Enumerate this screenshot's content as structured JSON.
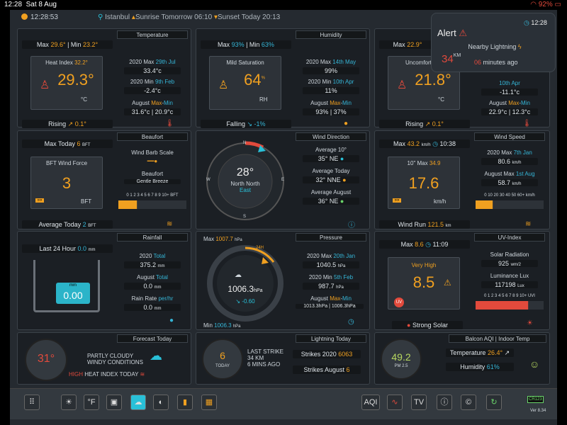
{
  "status": {
    "time": "12:28",
    "date": "Sat 8 Aug",
    "battery": "92%"
  },
  "topbar": {
    "clock": "12:28:53",
    "location": "Istanbul",
    "sunrise": "Sunrise Tomorrow 06:10",
    "sunset": "Sunset Today 20:13"
  },
  "temperature": {
    "header": "Temperature",
    "max_label": "Max",
    "max": "29.6°",
    "min_label": "Min",
    "min": "23.2°",
    "heat_index_label": "Heat Index",
    "heat_index": "32.2°",
    "value": "29.3°",
    "unit": "°C",
    "trend": "Rising",
    "trend_val": "0.1°",
    "y2020max_label": "2020 Max",
    "y2020max_date": "29th Jul",
    "y2020max": "33.4°c",
    "y2020min_label": "2020 Min",
    "y2020min_date": "9th Feb",
    "y2020min": "-2.4°c",
    "month_label": "August",
    "month_max": "Max",
    "month_min": "Min",
    "month_val": "31.6°c | 20.9°c"
  },
  "humidity": {
    "header": "Humidity",
    "max": "93%",
    "min": "63%",
    "sub": "Mild Saturation",
    "value": "64",
    "unit": "RH",
    "trend": "Falling",
    "trend_val": "-1%",
    "y2020max_label": "2020 Max",
    "y2020max_date": "14th May",
    "y2020max": "99%",
    "y2020min_label": "2020 Min",
    "y2020min_date": "10th Apr",
    "y2020min": "11%",
    "month_label": "August",
    "month_val": "93% | 37%"
  },
  "indoor": {
    "max": "22.9°",
    "sub": "Uncomfortable",
    "value": "21.8°",
    "unit": "°C",
    "trend": "Rising",
    "trend_val": "0.1°",
    "y2020min_date": "10th Apr",
    "y2020min": "-11.1°c",
    "month_label": "August",
    "month_val": "22.9°c | 12.3°c"
  },
  "alert": {
    "title": "Alert",
    "time": "12:28",
    "text": "Nearby Lightning",
    "dist": "34",
    "dist_unit": "KM",
    "mins": "06",
    "mins_label": "minutes ago"
  },
  "beaufort": {
    "header": "Beaufort",
    "max_today": "Max Today",
    "max_val": "6",
    "bft": "BFT",
    "force_label": "BFT Wind Force",
    "value": "3",
    "scale_label": "Wind Barb Scale",
    "beaufort_label": "Beaufort",
    "desc": "Gentle Breeze",
    "scale": "0 1 2 3 4 5 6 7 8 9 10+",
    "avg_label": "Average Today",
    "avg_val": "2"
  },
  "winddir": {
    "header": "Wind Direction",
    "degrees": "28°",
    "name": "North North",
    "name2": "East",
    "avg10_label": "Average 10°",
    "avg10": "35° NE",
    "avg_today_label": "Average Today",
    "avg_today": "32° NNE",
    "avg_aug_label": "Average August",
    "avg_aug": "36° NE",
    "n": "N",
    "e": "E",
    "s": "S",
    "w": "W"
  },
  "windspeed": {
    "header": "Wind Speed",
    "max": "Max",
    "max_val": "43.2",
    "max_unit": "km/h",
    "max_time": "10:38",
    "max10_label": "10\" Max",
    "max10": "34.9",
    "value": "17.6",
    "unit": "km/h",
    "y2020max_label": "2020 Max",
    "y2020max_date": "7th Jan",
    "y2020max": "80.6",
    "aug_max_label": "August Max",
    "aug_max_date": "1st Aug",
    "aug_max": "58.7",
    "scale": "0 10 20 30 40 50 60+",
    "run_label": "Wind Run",
    "run_val": "121.5",
    "run_unit": "km"
  },
  "rainfall": {
    "header": "Rainfall",
    "last24": "Last 24 Hour",
    "last24_val": "0.0",
    "mm": "mm",
    "value": "0.00",
    "y2020_label": "2020",
    "y2020_total": "Total",
    "y2020": "375.2",
    "aug_label": "August",
    "aug_total": "Total",
    "aug": "0.0",
    "rate_label": "Rain Rate",
    "rate_unit": "per/hr",
    "rate": "0.0"
  },
  "pressure": {
    "header": "Pressure",
    "max": "Max",
    "max_val": "1007.7",
    "hpa": "hPa",
    "value": "1006.3",
    "trend": "-0.60",
    "min": "Min",
    "min_val": "1006.3",
    "y2020max_label": "2020 Max",
    "y2020max_date": "20th Jan",
    "y2020max": "1040.5",
    "y2020min_label": "2020 Min",
    "y2020min_date": "5th Feb",
    "y2020min": "987.7",
    "aug_label": "August",
    "aug_val": "1013.3hPa | 1006.3hPa",
    "tag": "24H"
  },
  "uv": {
    "header": "UV-Index",
    "max": "Max",
    "max_val": "8.6",
    "max_time": "11:09",
    "level": "Very High",
    "value": "8.5",
    "solar_label": "Solar Radiation",
    "solar": "925",
    "solar_unit": "wm/2",
    "lux_label": "Luminance Lux",
    "lux": "117198",
    "lux_unit": "Lux",
    "scale": "0 1 2 3 4 5 6 7 8 9 10+",
    "uv_unit": "UVI",
    "strong": "Strong Solar"
  },
  "forecast": {
    "header": "Forecast Today",
    "temp": "31°",
    "text1": "PARTLY CLOUDY",
    "text2": "WINDY CONDITIONS",
    "high": "HIGH",
    "heat": "HEAT INDEX",
    "today": "TODAY"
  },
  "lightning": {
    "header": "Lightning Today",
    "count": "6",
    "count_label": "TODAY",
    "last1": "LAST STRIKE",
    "last2": "34 KM",
    "last3": "6 MINS AGO",
    "y2020_label": "Strikes 2020",
    "y2020": "6063",
    "aug_label": "Strikes August",
    "aug": "6"
  },
  "aqi": {
    "header": "Balcon AQI | Indoor Temp",
    "value": "49.2",
    "pm": "PM 2.5",
    "temp_label": "Temperature",
    "temp": "26.4°",
    "hum_label": "Humidity",
    "hum": "61%"
  },
  "dock": {
    "f": "°F",
    "aqi": "AQI",
    "tv": "TV",
    "ver": "Ver 8.34",
    "logo": "CR123"
  }
}
